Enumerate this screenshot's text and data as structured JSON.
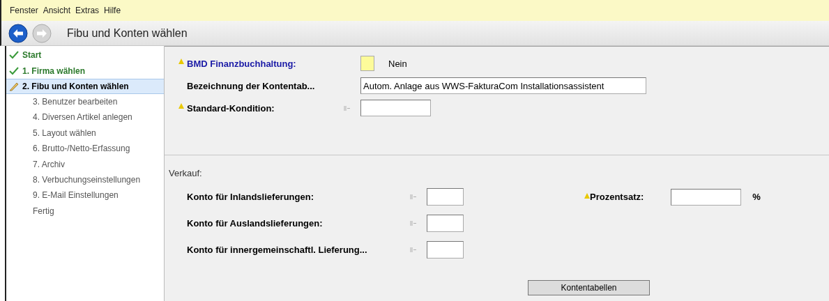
{
  "menu": [
    {
      "label": "Fenster"
    },
    {
      "label": "Ansicht"
    },
    {
      "label": "Extras"
    },
    {
      "label": "Hilfe"
    }
  ],
  "nav": {
    "back_enabled": true,
    "forward_enabled": false
  },
  "page_title": "Fibu und Konten wählen",
  "steps": [
    {
      "label": "Start",
      "kind": "done",
      "selected": false
    },
    {
      "label": "1. Firma wählen",
      "kind": "done",
      "selected": false
    },
    {
      "label": "2. Fibu und Konten wählen",
      "kind": "current",
      "selected": true
    },
    {
      "label": "3. Benutzer bearbeiten",
      "kind": "pending",
      "selected": false
    },
    {
      "label": "4. Diversen Artikel anlegen",
      "kind": "pending",
      "selected": false
    },
    {
      "label": "5. Layout wählen",
      "kind": "pending",
      "selected": false
    },
    {
      "label": "6. Brutto-/Netto-Erfassung",
      "kind": "pending",
      "selected": false
    },
    {
      "label": "7. Archiv",
      "kind": "pending",
      "selected": false
    },
    {
      "label": "8. Verbuchungseinstellungen",
      "kind": "pending",
      "selected": false
    },
    {
      "label": "9. E-Mail Einstellungen",
      "kind": "pending",
      "selected": false
    },
    {
      "label": "Fertig",
      "kind": "pending",
      "selected": false
    }
  ],
  "top_fields": [
    {
      "kind": "toggle",
      "label": "BMD Finanzbuchhaltung:",
      "required": true,
      "highlight": true,
      "lookup": false,
      "checked": false,
      "value": "Nein"
    },
    {
      "kind": "long-text",
      "label": "Bezeichnung der Kontentab...",
      "required": false,
      "highlight": false,
      "lookup": false,
      "value": "Autom. Anlage aus WWS-FakturaCom Installationsassistent"
    },
    {
      "kind": "short-text",
      "label": "Standard-Kondition:",
      "required": true,
      "highlight": false,
      "lookup": true
    }
  ],
  "section": {
    "title": "Verkauf:",
    "fields": [
      {
        "label": "Konto für Inlandslieferungen:",
        "required": false,
        "lookup": true
      },
      {
        "label": "Konto für Auslandslieferungen:",
        "required": false,
        "lookup": true
      },
      {
        "label": "Konto für innergemeinschaftl. Lieferung...",
        "required": false,
        "lookup": true
      }
    ],
    "side_field": {
      "label": "Prozentsatz:",
      "required": true,
      "unit": "%"
    }
  },
  "button": "Kontentabellen"
}
